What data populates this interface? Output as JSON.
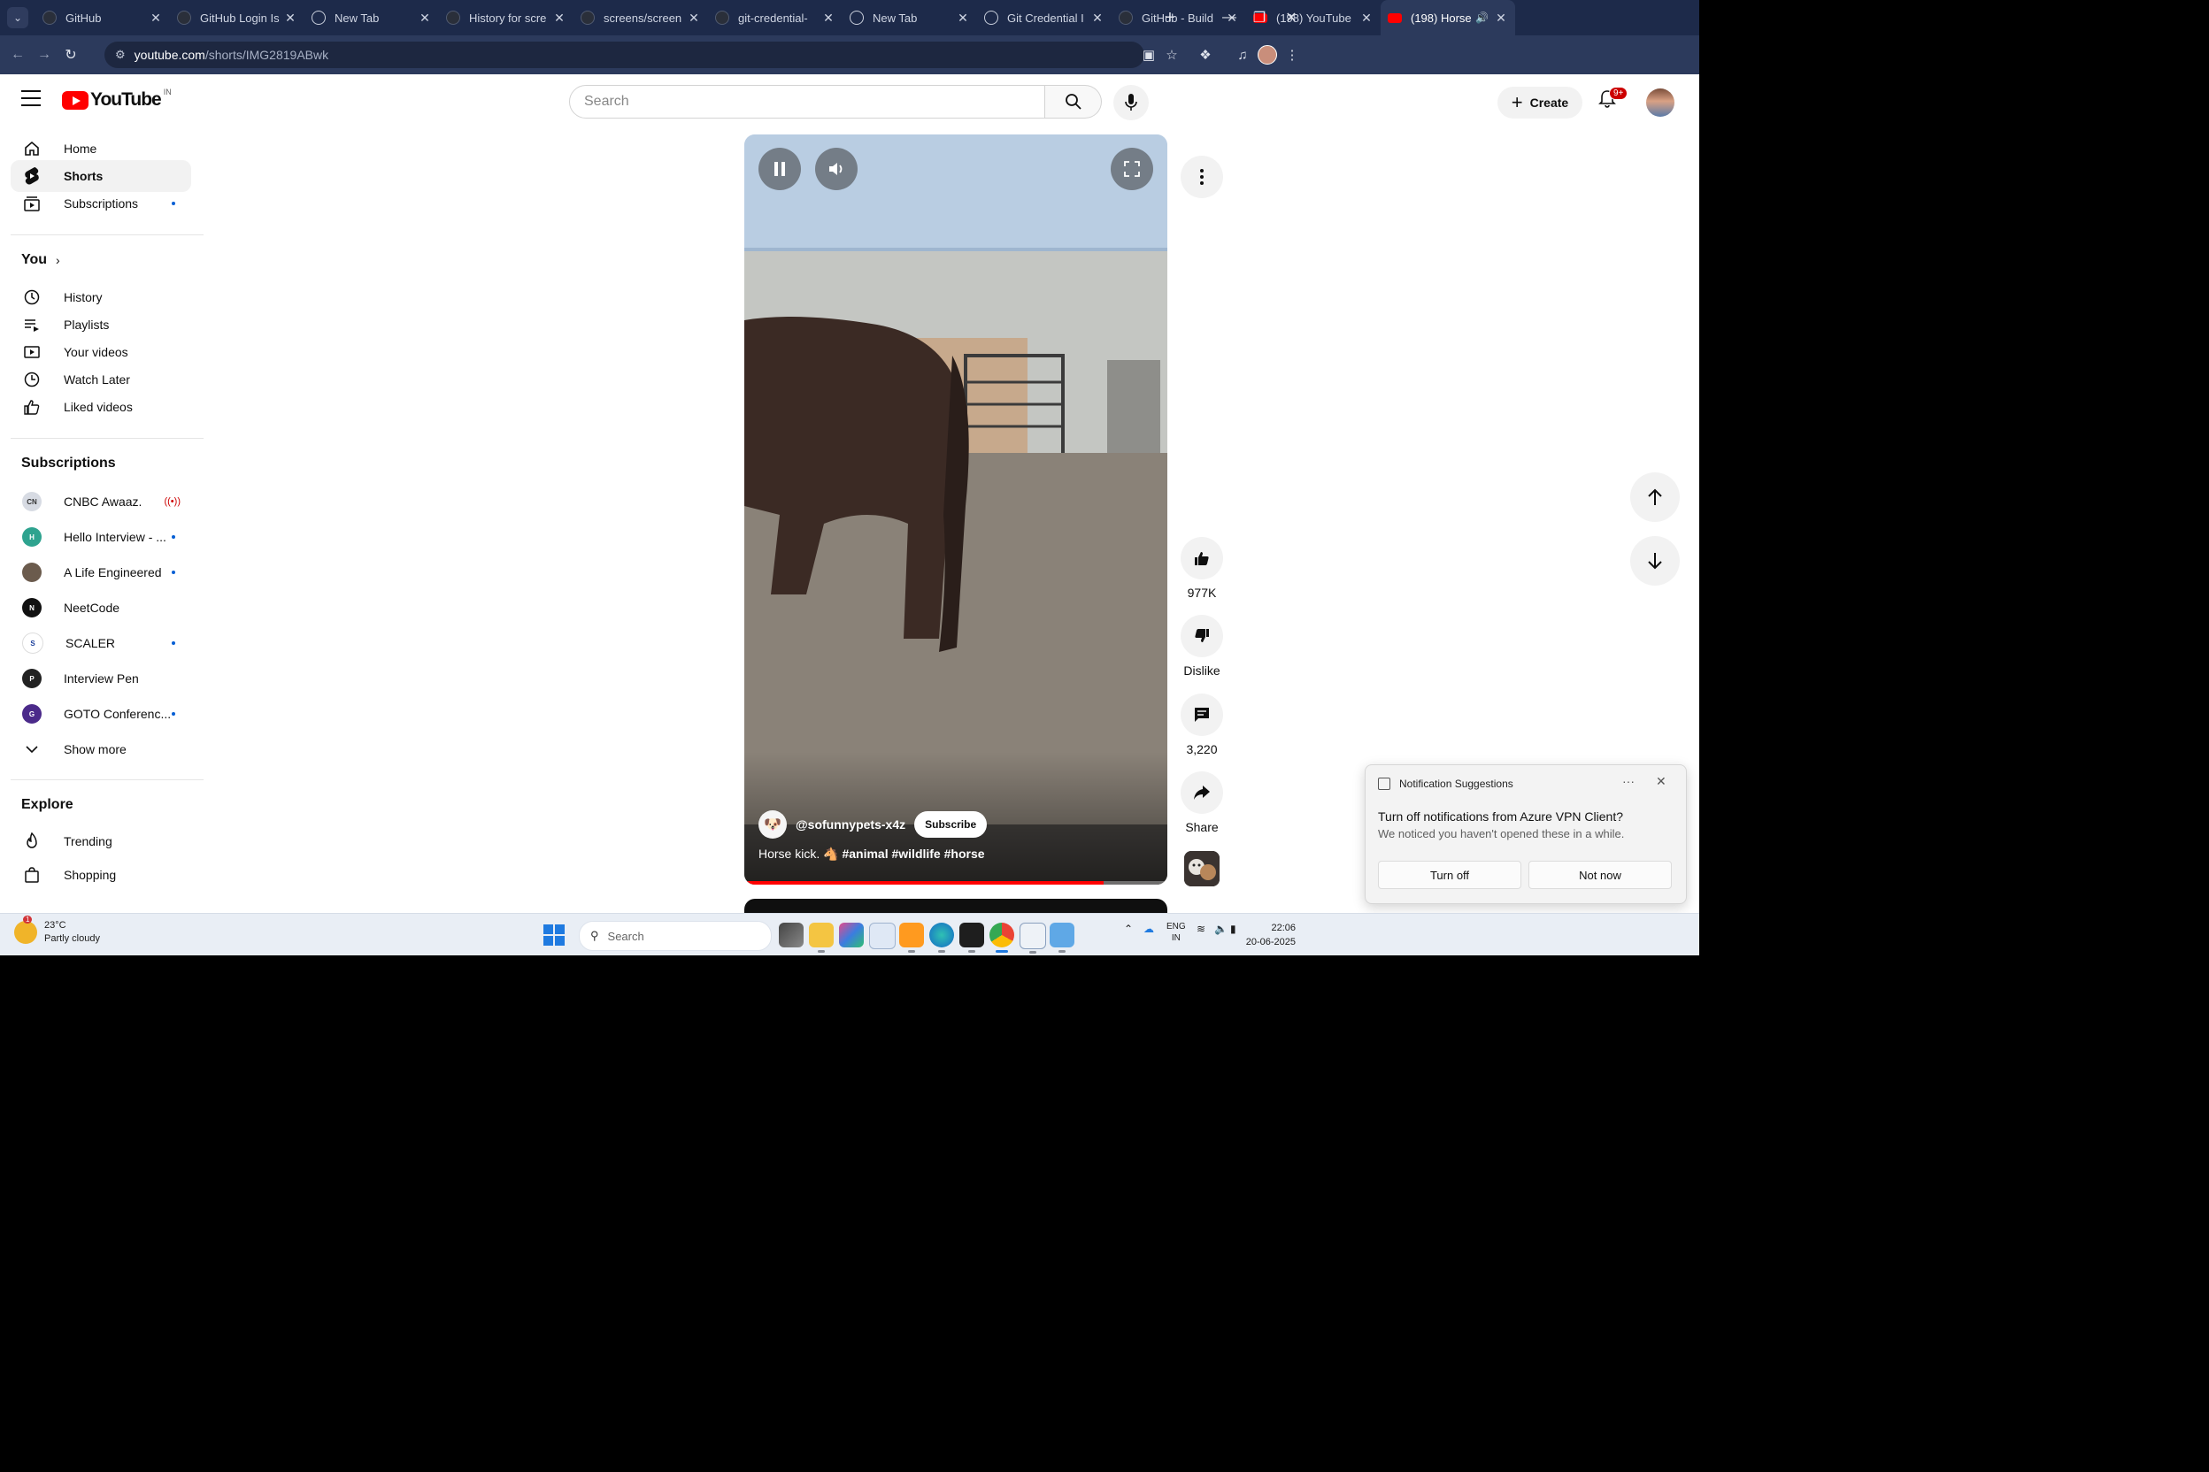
{
  "browser": {
    "tabs": [
      {
        "label": "GitHub",
        "icon": "github-icon"
      },
      {
        "label": "GitHub Login Is",
        "icon": "github-icon"
      },
      {
        "label": "New Tab",
        "icon": "chrome-icon"
      },
      {
        "label": "History for scre",
        "icon": "github-icon"
      },
      {
        "label": "screens/screen",
        "icon": "github-icon"
      },
      {
        "label": "git-credential-",
        "icon": "github-icon"
      },
      {
        "label": "New Tab",
        "icon": "chrome-icon"
      },
      {
        "label": "Git Credential I",
        "icon": "globe-icon"
      },
      {
        "label": "GitHub - Build",
        "icon": "github-icon"
      },
      {
        "label": "(198) YouTube",
        "icon": "youtube-icon"
      },
      {
        "label": "(198) Horse",
        "icon": "youtube-icon",
        "active": true
      }
    ],
    "url_host": "youtube.com",
    "url_path": "/shorts/IMG2819ABwk"
  },
  "header": {
    "logo_text": "YouTube",
    "country_code": "IN",
    "search_placeholder": "Search",
    "create_label": "Create",
    "notification_badge": "9+"
  },
  "sidebar": {
    "main": [
      {
        "label": "Home",
        "icon": "home-icon"
      },
      {
        "label": "Shorts",
        "icon": "shorts-icon",
        "active": true
      },
      {
        "label": "Subscriptions",
        "icon": "subscriptions-icon",
        "dot": true
      }
    ],
    "you_heading": "You",
    "you_items": [
      {
        "label": "History",
        "icon": "history-icon"
      },
      {
        "label": "Playlists",
        "icon": "playlists-icon"
      },
      {
        "label": "Your videos",
        "icon": "your-videos-icon"
      },
      {
        "label": "Watch Later",
        "icon": "watch-later-icon"
      },
      {
        "label": "Liked videos",
        "icon": "liked-videos-icon"
      }
    ],
    "subs_heading": "Subscriptions",
    "subscriptions": [
      {
        "label": "CNBC Awaaz.",
        "live": true,
        "color": "#d7dbe3"
      },
      {
        "label": "Hello Interview - ...",
        "dot": true,
        "color": "#2ea38f"
      },
      {
        "label": "A Life Engineered",
        "dot": true,
        "color": "#6b5b4d"
      },
      {
        "label": "NeetCode",
        "color": "#111111"
      },
      {
        "label": "SCALER",
        "dot": true,
        "color": "#ffffff"
      },
      {
        "label": "Interview Pen",
        "color": "#222222"
      },
      {
        "label": "GOTO Conferenc...",
        "dot": true,
        "color": "#4b2a8a"
      }
    ],
    "show_more": "Show more",
    "explore_heading": "Explore",
    "explore_items": [
      {
        "label": "Trending",
        "icon": "trending-icon"
      },
      {
        "label": "Shopping",
        "icon": "shopping-icon"
      }
    ]
  },
  "short": {
    "channel": "@sofunnypets-x4z",
    "subscribe_label": "Subscribe",
    "caption_text": "Horse kick. 🐴",
    "hashtags": [
      "#animal",
      "#wildlife",
      "#horse"
    ],
    "progress": 0.85
  },
  "actions": {
    "likes": "977K",
    "dislike_label": "Dislike",
    "comments": "3,220",
    "share_label": "Share"
  },
  "toast": {
    "title": "Notification Suggestions",
    "line1": "Turn off notifications from Azure VPN Client?",
    "line2": "We noticed you haven't opened these in a while.",
    "turn_off": "Turn off",
    "not_now": "Not now"
  },
  "taskbar": {
    "temperature": "23°C",
    "weather": "Partly cloudy",
    "weather_alert": "1",
    "search_placeholder": "Search",
    "lang": "ENG",
    "region": "IN",
    "time": "22:06",
    "date": "20-06-2025"
  },
  "colors": {
    "brand_red": "#ff0000",
    "browser_frame": "#1d2a4a",
    "link_blue": "#065fd4"
  }
}
